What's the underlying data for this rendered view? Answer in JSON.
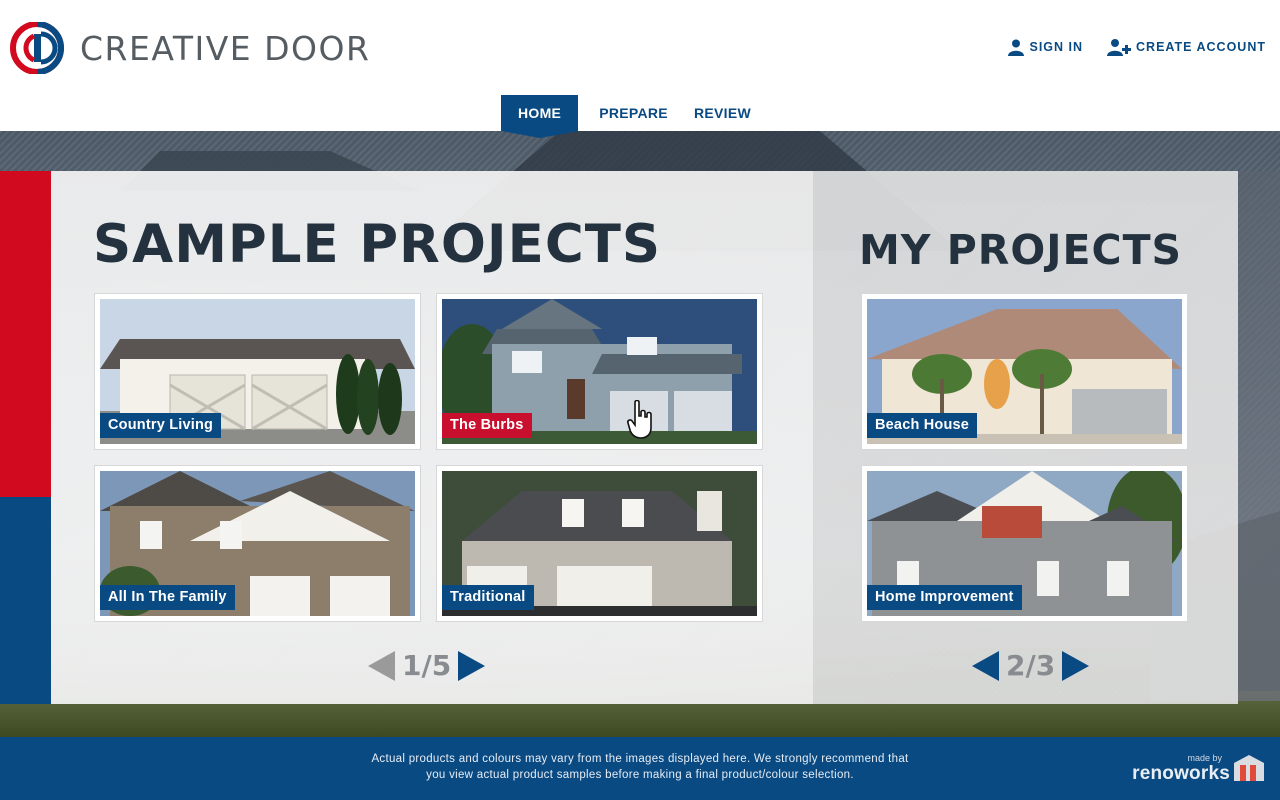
{
  "header": {
    "brand_name": "CREATIVE DOOR",
    "sign_in": "SIGN IN",
    "create_account": "CREATE ACCOUNT"
  },
  "nav": {
    "tabs": [
      {
        "label": "HOME",
        "active": true
      },
      {
        "label": "PREPARE",
        "active": false
      },
      {
        "label": "REVIEW",
        "active": false
      }
    ]
  },
  "sample_projects": {
    "title": "SAMPLE PROJECTS",
    "cards": [
      {
        "label": "Country Living",
        "label_color": "blue"
      },
      {
        "label": "The Burbs",
        "label_color": "red"
      },
      {
        "label": "All In The Family",
        "label_color": "blue"
      },
      {
        "label": "Traditional",
        "label_color": "blue"
      }
    ],
    "pager": "1/5"
  },
  "my_projects": {
    "title": "MY PROJECTS",
    "cards": [
      {
        "label": "Beach House",
        "label_color": "blue"
      },
      {
        "label": "Home Improvement",
        "label_color": "blue"
      }
    ],
    "pager": "2/3"
  },
  "footer": {
    "disclaimer_line1": "Actual products and colours may vary from the images displayed here. We strongly recommend that",
    "disclaimer_line2": "you view actual product samples before making a final product/colour selection.",
    "made_by": "made by",
    "renoworks": "renoworks"
  },
  "colors": {
    "brand_blue": "#0a4a83",
    "brand_red": "#d20a20",
    "title_dark": "#24323f"
  },
  "icons": {
    "user": "user-icon",
    "add_user": "add-user-icon",
    "prev": "arrow-left-icon",
    "next": "arrow-right-icon"
  }
}
